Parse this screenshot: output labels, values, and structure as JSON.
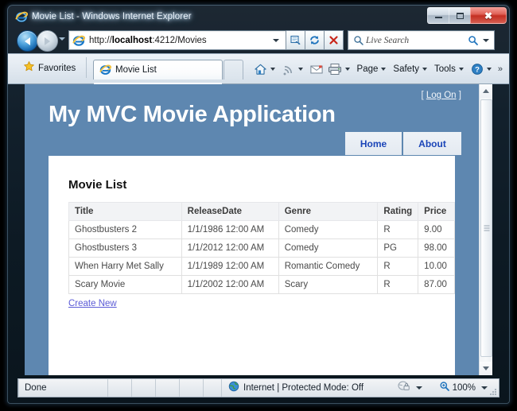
{
  "window": {
    "title": "Movie List - Windows Internet Explorer",
    "controls": {
      "minimize": "Minimize",
      "maximize": "Maximize",
      "close": "Close"
    }
  },
  "browser": {
    "address": {
      "url_prefix": "http://",
      "url_host": "localhost",
      "url_rest": ":4212/Movies",
      "full_url": "http://localhost:4212/Movies"
    },
    "search": {
      "placeholder": "Live Search"
    },
    "favorites_label": "Favorites",
    "tabs": [
      {
        "label": "Movie List"
      },
      {
        "label": ""
      }
    ],
    "command_bar": {
      "page": "Page",
      "safety": "Safety",
      "tools": "Tools",
      "overflow": "»"
    }
  },
  "page": {
    "log_on": {
      "open_bracket": "[",
      "label": "Log On",
      "close_bracket": "]"
    },
    "app_title": "My MVC Movie Application",
    "nav": [
      {
        "label": "Home"
      },
      {
        "label": "About"
      }
    ],
    "heading": "Movie List",
    "table": {
      "columns": [
        "Title",
        "ReleaseDate",
        "Genre",
        "Rating",
        "Price"
      ],
      "rows": [
        [
          "Ghostbusters 2",
          "1/1/1986 12:00 AM",
          "Comedy",
          "R",
          "9.00"
        ],
        [
          "Ghostbusters 3",
          "1/1/2012 12:00 AM",
          "Comedy",
          "PG",
          "98.00"
        ],
        [
          "When Harry Met Sally",
          "1/1/1989 12:00 AM",
          "Romantic Comedy",
          "R",
          "10.00"
        ],
        [
          "Scary Movie",
          "1/1/2002 12:00 AM",
          "Scary",
          "R",
          "87.00"
        ]
      ]
    },
    "create_new": "Create New"
  },
  "statusbar": {
    "status": "Done",
    "zone": "Internet | Protected Mode: Off",
    "zoom": "100%"
  },
  "colors": {
    "page_header_blue": "#5e87b0",
    "nav_link_blue": "#1b45b8",
    "link_purple": "#5b5bd6",
    "table_header_bg": "#f2f3f5",
    "table_border": "#e0e0e0",
    "close_button_red": "#c42e22"
  }
}
